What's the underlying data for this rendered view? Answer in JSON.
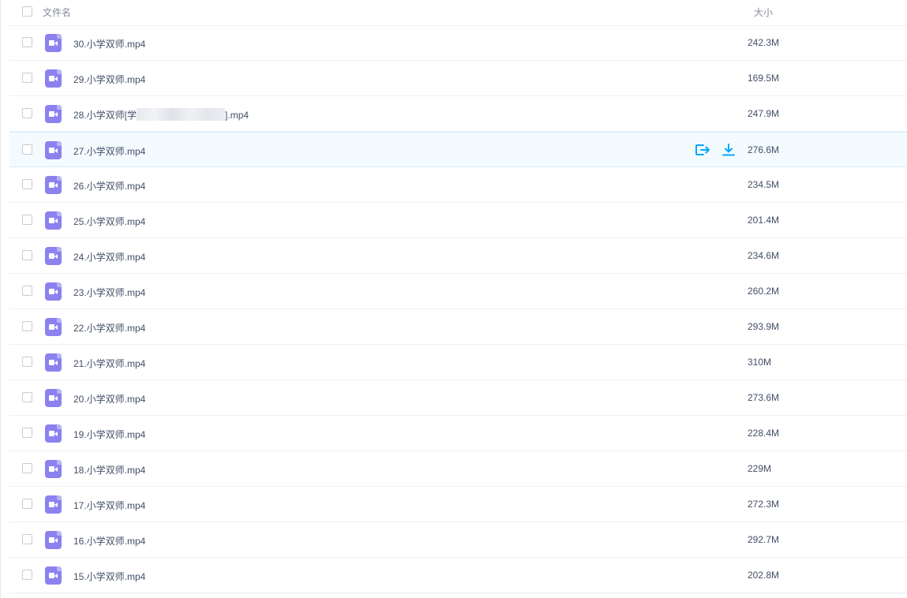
{
  "header": {
    "name_label": "文件名",
    "size_label": "大小"
  },
  "files": [
    {
      "name": "30.小学双师.mp4",
      "size": "242.3M"
    },
    {
      "name": "29.小学双师.mp4",
      "size": "169.5M"
    },
    {
      "name_prefix": "28.小学双师[学",
      "name_suffix": "].mp4",
      "size": "247.9M",
      "redacted": true
    },
    {
      "name": "27.小学双师.mp4",
      "size": "276.6M",
      "hover": true
    },
    {
      "name": "26.小学双师.mp4",
      "size": "234.5M"
    },
    {
      "name": "25.小学双师.mp4",
      "size": "201.4M"
    },
    {
      "name": "24.小学双师.mp4",
      "size": "234.6M"
    },
    {
      "name": "23.小学双师.mp4",
      "size": "260.2M"
    },
    {
      "name": "22.小学双师.mp4",
      "size": "293.9M"
    },
    {
      "name": "21.小学双师.mp4",
      "size": "310M"
    },
    {
      "name": "20.小学双师.mp4",
      "size": "273.6M"
    },
    {
      "name": "19.小学双师.mp4",
      "size": "228.4M"
    },
    {
      "name": "18.小学双师.mp4",
      "size": "229M"
    },
    {
      "name": "17.小学双师.mp4",
      "size": "272.3M"
    },
    {
      "name": "16.小学双师.mp4",
      "size": "292.7M"
    },
    {
      "name": "15.小学双师.mp4",
      "size": "202.8M"
    }
  ],
  "icons": {
    "file_type": "video-file-icon",
    "row_actions": [
      "share-icon",
      "download-icon"
    ]
  },
  "colors": {
    "video_icon": "#8b82f0",
    "action_accent": "#06a7ff",
    "hover_row": "#f4fbff"
  }
}
